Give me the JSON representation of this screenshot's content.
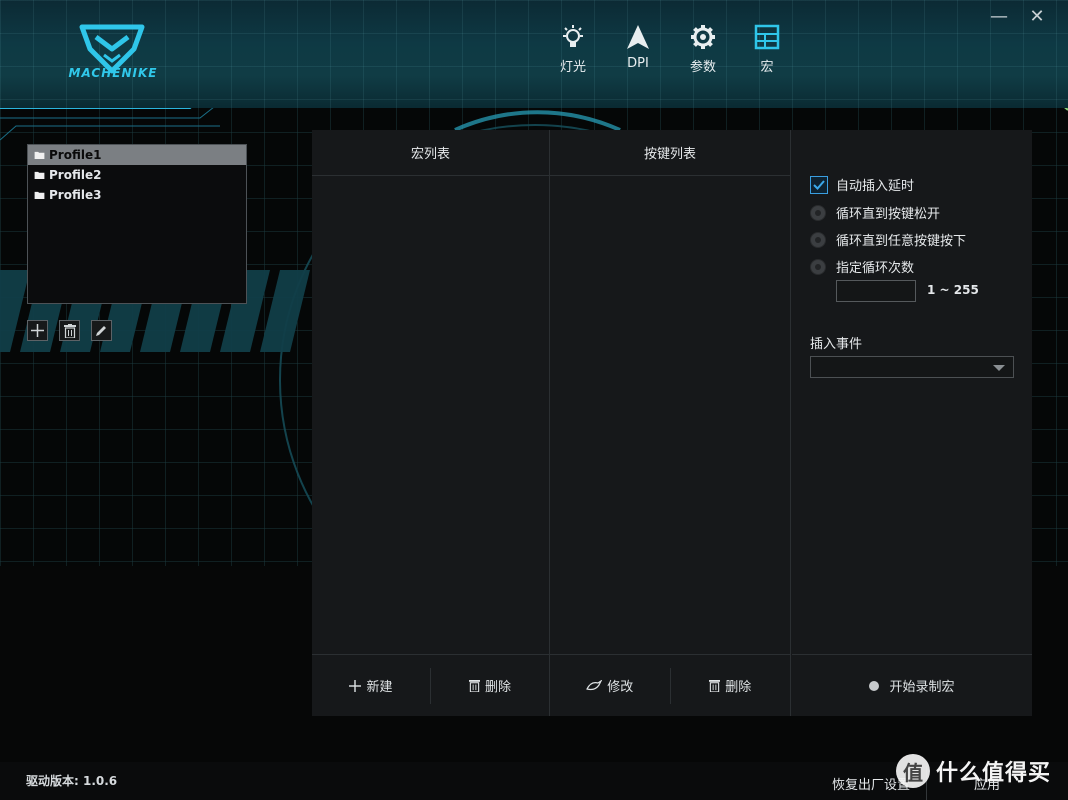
{
  "colors": {
    "accent": "#2fc6ea",
    "selected_row": "#7b7f83",
    "panel_bg": "#16181a",
    "checkbox_border": "#3a9ee0"
  },
  "header": {
    "logo_text": "MACHENIKE",
    "nav": [
      {
        "label": "灯光",
        "icon": "bulb-icon"
      },
      {
        "label": "DPI",
        "icon": "cursor-arrow-icon"
      },
      {
        "label": "参数",
        "icon": "gear-icon"
      },
      {
        "label": "宏",
        "icon": "grid-icon",
        "active": true
      }
    ],
    "window_controls": {
      "minimize": "—",
      "close": "✕"
    }
  },
  "profiles": {
    "items": [
      "Profile1",
      "Profile2",
      "Profile3"
    ],
    "selected_index": 0,
    "tools": [
      "add-icon",
      "trash-icon",
      "pencil-icon"
    ]
  },
  "macro_list": {
    "header": "宏列表",
    "new_label": "新建",
    "delete_label": "删除"
  },
  "key_list": {
    "header": "按键列表",
    "modify_label": "修改",
    "delete_label": "删除"
  },
  "options": {
    "auto_insert_delay": {
      "label": "自动插入延时",
      "checked": true
    },
    "radios": [
      "循环直到按键松开",
      "循环直到任意按键按下",
      "指定循环次数"
    ],
    "loop_count_value": "",
    "loop_range": "1 ~ 255",
    "insert_event_label": "插入事件",
    "insert_event_value": "",
    "record_label": "开始录制宏"
  },
  "footer": {
    "version": "驱动版本: 1.0.6",
    "reset_label": "恢复出厂设置",
    "apply_label": "应用",
    "watermark_badge": "值",
    "watermark_text": "什么值得买"
  }
}
